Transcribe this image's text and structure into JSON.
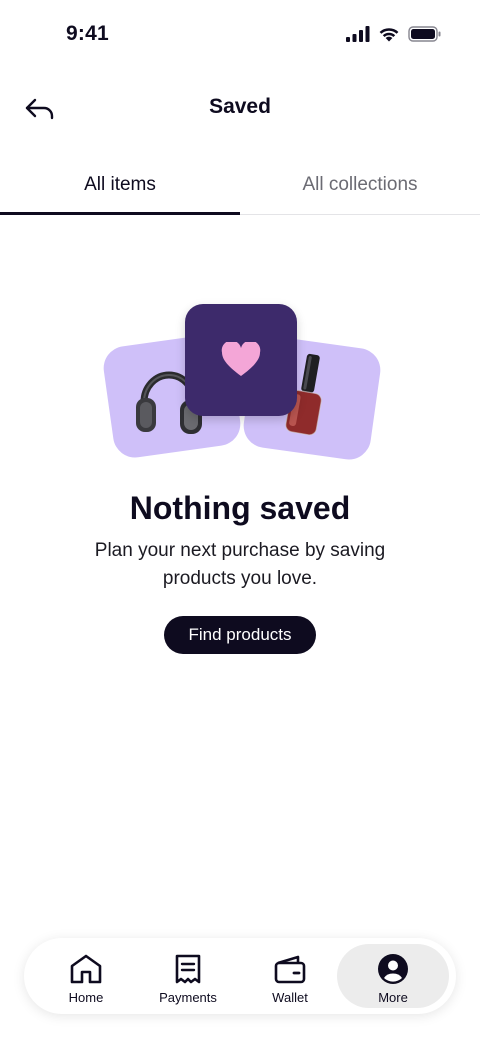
{
  "status_bar": {
    "time": "9:41"
  },
  "header": {
    "title": "Saved"
  },
  "tabs": [
    {
      "label": "All items",
      "active": true
    },
    {
      "label": "All collections",
      "active": false
    }
  ],
  "empty_state": {
    "title": "Nothing saved",
    "description": "Plan your next purchase by saving products you love.",
    "button_label": "Find products"
  },
  "bottom_nav": [
    {
      "label": "Home",
      "icon": "home-icon",
      "active": false
    },
    {
      "label": "Payments",
      "icon": "receipt-icon",
      "active": false
    },
    {
      "label": "Wallet",
      "icon": "wallet-icon",
      "active": false
    },
    {
      "label": "More",
      "icon": "profile-icon",
      "active": true
    }
  ],
  "colors": {
    "accent_dark": "#0e0b1f",
    "card_lavender": "#cfc0f9",
    "card_purple": "#3d2a6b",
    "heart_pink": "#f4a6d7"
  }
}
